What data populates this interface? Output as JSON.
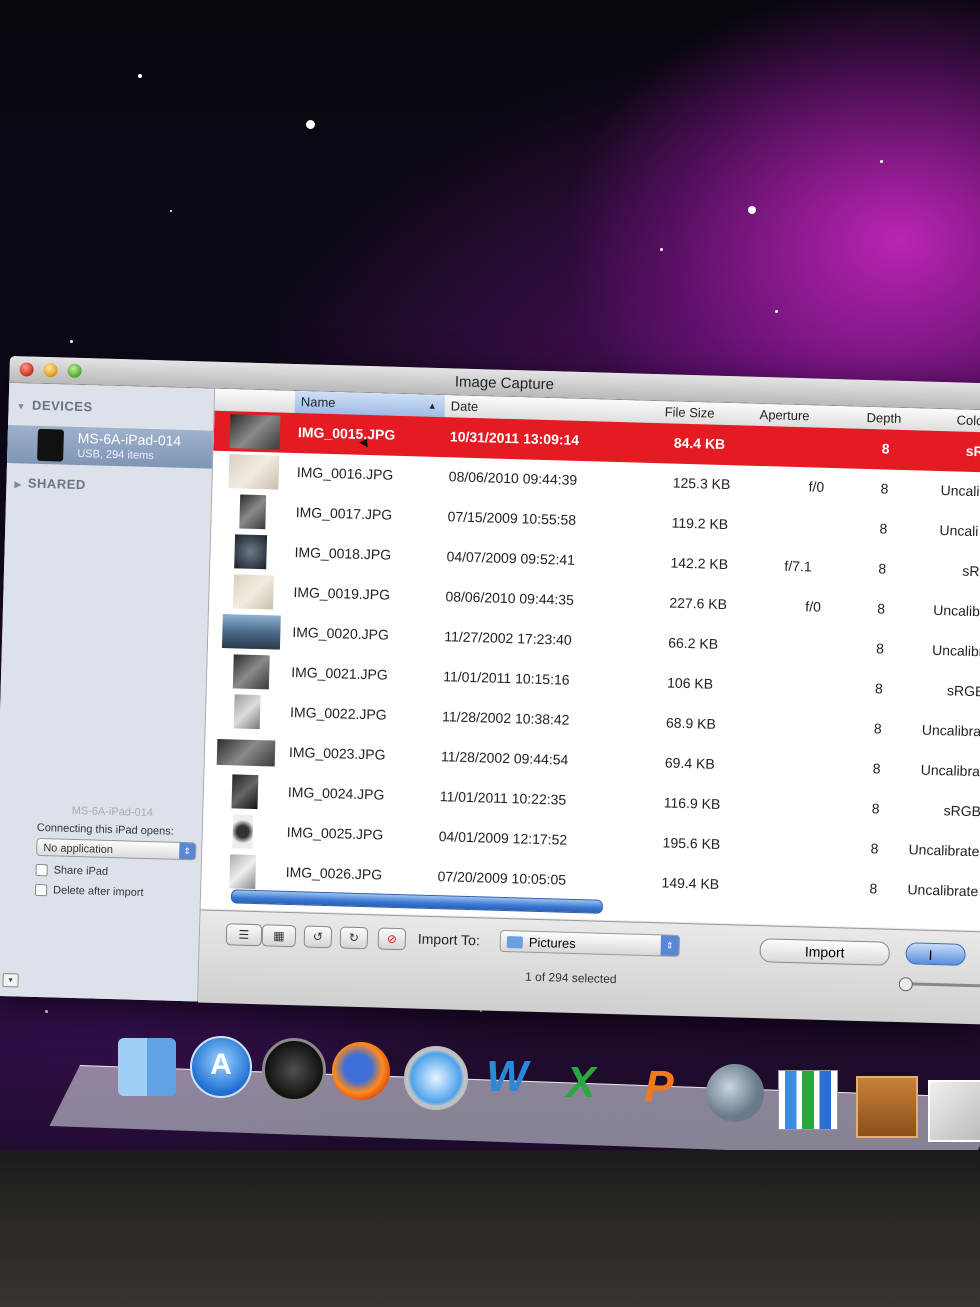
{
  "window": {
    "title": "Image Capture"
  },
  "sidebar": {
    "devices_header": "DEVICES",
    "device": {
      "name": "MS-6A-iPad-014",
      "sub": "USB, 294 items"
    },
    "shared_header": "SHARED",
    "device_label": "MS-6A-iPad-014",
    "connecting_label": "Connecting this iPad opens:",
    "connecting_value": "No application",
    "share_label": "Share iPad",
    "delete_label": "Delete after import"
  },
  "table": {
    "columns": [
      "Name",
      "Date",
      "File Size",
      "Aperture",
      "Depth",
      "Colo"
    ],
    "rows": [
      {
        "name": "IMG_0015.JPG",
        "date": "10/31/2011 13:09:14",
        "size": "84.4 KB",
        "aperture": "",
        "depth": "8",
        "color": "sR"
      },
      {
        "name": "IMG_0016.JPG",
        "date": "08/06/2010 09:44:39",
        "size": "125.3 KB",
        "aperture": "f/0",
        "depth": "8",
        "color": "Uncali"
      },
      {
        "name": "IMG_0017.JPG",
        "date": "07/15/2009 10:55:58",
        "size": "119.2 KB",
        "aperture": "",
        "depth": "8",
        "color": "Uncali"
      },
      {
        "name": "IMG_0018.JPG",
        "date": "04/07/2009 09:52:41",
        "size": "142.2 KB",
        "aperture": "f/7.1",
        "depth": "8",
        "color": "sRC"
      },
      {
        "name": "IMG_0019.JPG",
        "date": "08/06/2010 09:44:35",
        "size": "227.6 KB",
        "aperture": "f/0",
        "depth": "8",
        "color": "Uncalib"
      },
      {
        "name": "IMG_0020.JPG",
        "date": "11/27/2002 17:23:40",
        "size": "66.2 KB",
        "aperture": "",
        "depth": "8",
        "color": "Uncalibr"
      },
      {
        "name": "IMG_0021.JPG",
        "date": "11/01/2011 10:15:16",
        "size": "106 KB",
        "aperture": "",
        "depth": "8",
        "color": "sRGB"
      },
      {
        "name": "IMG_0022.JPG",
        "date": "11/28/2002 10:38:42",
        "size": "68.9 KB",
        "aperture": "",
        "depth": "8",
        "color": "Uncalibra"
      },
      {
        "name": "IMG_0023.JPG",
        "date": "11/28/2002 09:44:54",
        "size": "69.4 KB",
        "aperture": "",
        "depth": "8",
        "color": "Uncalibrat"
      },
      {
        "name": "IMG_0024.JPG",
        "date": "11/01/2011 10:22:35",
        "size": "116.9 KB",
        "aperture": "",
        "depth": "8",
        "color": "sRGB"
      },
      {
        "name": "IMG_0025.JPG",
        "date": "04/01/2009 12:17:52",
        "size": "195.6 KB",
        "aperture": "",
        "depth": "8",
        "color": "Uncalibrate"
      },
      {
        "name": "IMG_0026.JPG",
        "date": "07/20/2009 10:05:05",
        "size": "149.4 KB",
        "aperture": "",
        "depth": "8",
        "color": "Uncalibrate"
      }
    ]
  },
  "toolbar": {
    "import_to_label": "Import To:",
    "destination": "Pictures",
    "import_label": "Import",
    "import_all_label": "I",
    "status": "1 of 294 selected"
  },
  "colors": {
    "selection": "#e51b24",
    "accent": "#3b78d4"
  },
  "dock": {
    "icons": [
      "finder-icon",
      "app-store-icon",
      "dashboard-icon",
      "firefox-icon",
      "safari-icon",
      "word-icon",
      "excel-icon",
      "powerpoint-icon",
      "preview-icon",
      "numbers-icon",
      "keynote-icon",
      "iphoto-icon"
    ]
  }
}
